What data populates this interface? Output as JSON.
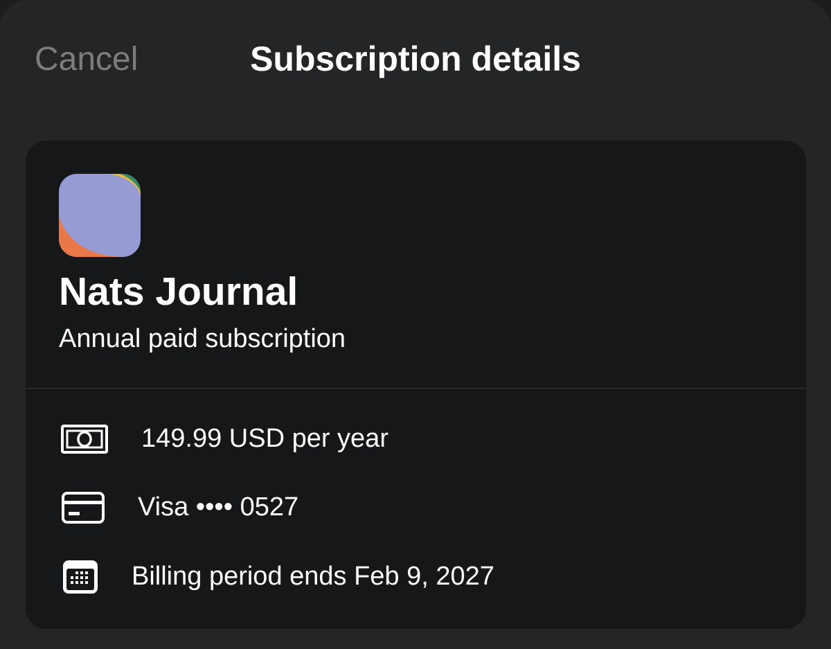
{
  "nav": {
    "cancel_label": "Cancel",
    "title": "Subscription details"
  },
  "subscription": {
    "app_name": "Nats Journal",
    "plan": "Annual paid subscription",
    "details": {
      "price": "149.99 USD per year",
      "payment_method": "Visa •••• 0527",
      "billing_period": "Billing period ends Feb 9, 2027"
    }
  },
  "icons": {
    "price": "banknote-icon",
    "payment": "credit-card-icon",
    "billing": "calendar-icon"
  },
  "colors": {
    "background": "#232526",
    "card": "#161718",
    "cancel_text": "#7b7d7f",
    "app_icon_main": "#979bd4",
    "app_icon_orange": "#e8774a",
    "app_icon_green": "#2f8a6a",
    "app_icon_yellow": "#e5b83c"
  }
}
